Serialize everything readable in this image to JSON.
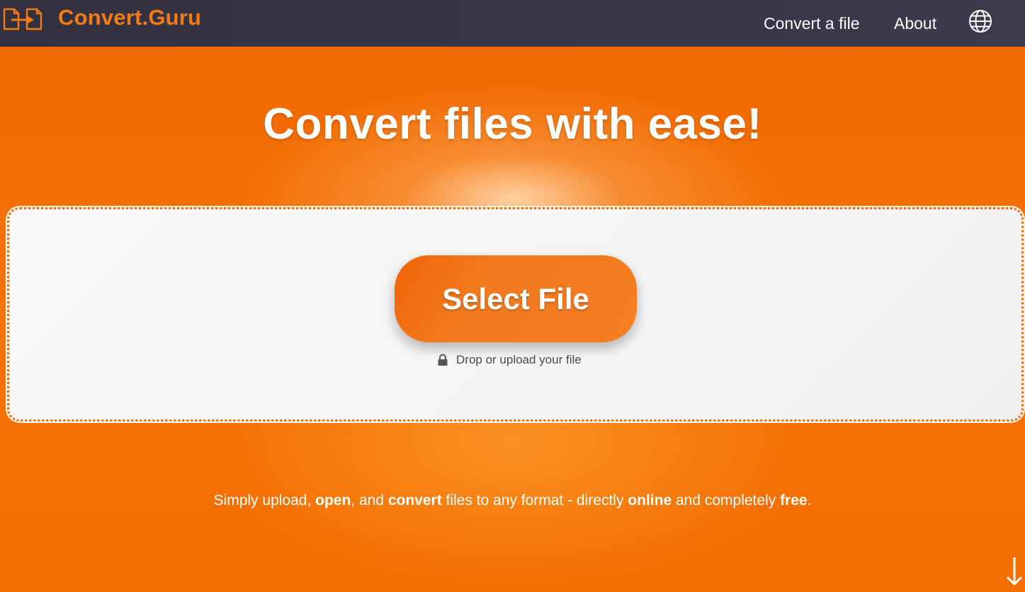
{
  "navbar": {
    "brand_name": "Convert.Guru",
    "links": {
      "convert": "Convert a file",
      "about": "About"
    },
    "language_icon": "globe-icon"
  },
  "hero": {
    "headline": "Convert files with ease!",
    "select_button": "Select File",
    "drop_hint": "Drop or upload your file",
    "tagline": {
      "p1": "Simply upload, ",
      "b1": "open",
      "p2": ", and ",
      "b2": "convert",
      "p3": " files to any format - directly ",
      "b3": "online",
      "p4": " and completely ",
      "b4": "free",
      "p5": "."
    }
  },
  "colors": {
    "accent": "#f46e02",
    "navbar": "#33313f",
    "brand": "#f47a13",
    "dropzone": "#f7f7f7"
  }
}
